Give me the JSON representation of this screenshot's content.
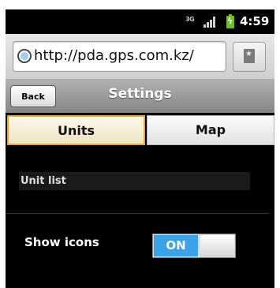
{
  "status_bar": {
    "network": "3G",
    "time": "4:59",
    "battery_color": "#6cc21f",
    "signal_icon": "signal-bars-icon",
    "battery_icon": "battery-charging-icon"
  },
  "browser": {
    "url": "http://pda.gps.com.kz/",
    "site_icon": "globe-icon",
    "bookmark_icon": "bookmark-star-icon"
  },
  "header": {
    "back_label": "Back",
    "title": "Settings"
  },
  "tabs": [
    {
      "label": "Units",
      "active": true
    },
    {
      "label": "Map",
      "active": false
    }
  ],
  "settings": {
    "unit_list_label": "Unit list",
    "show_icons_label": "Show icons",
    "show_icons_toggle": "ON",
    "toggle_on_color": "#3ba2e6",
    "active_tab_color": "#f0a425"
  }
}
